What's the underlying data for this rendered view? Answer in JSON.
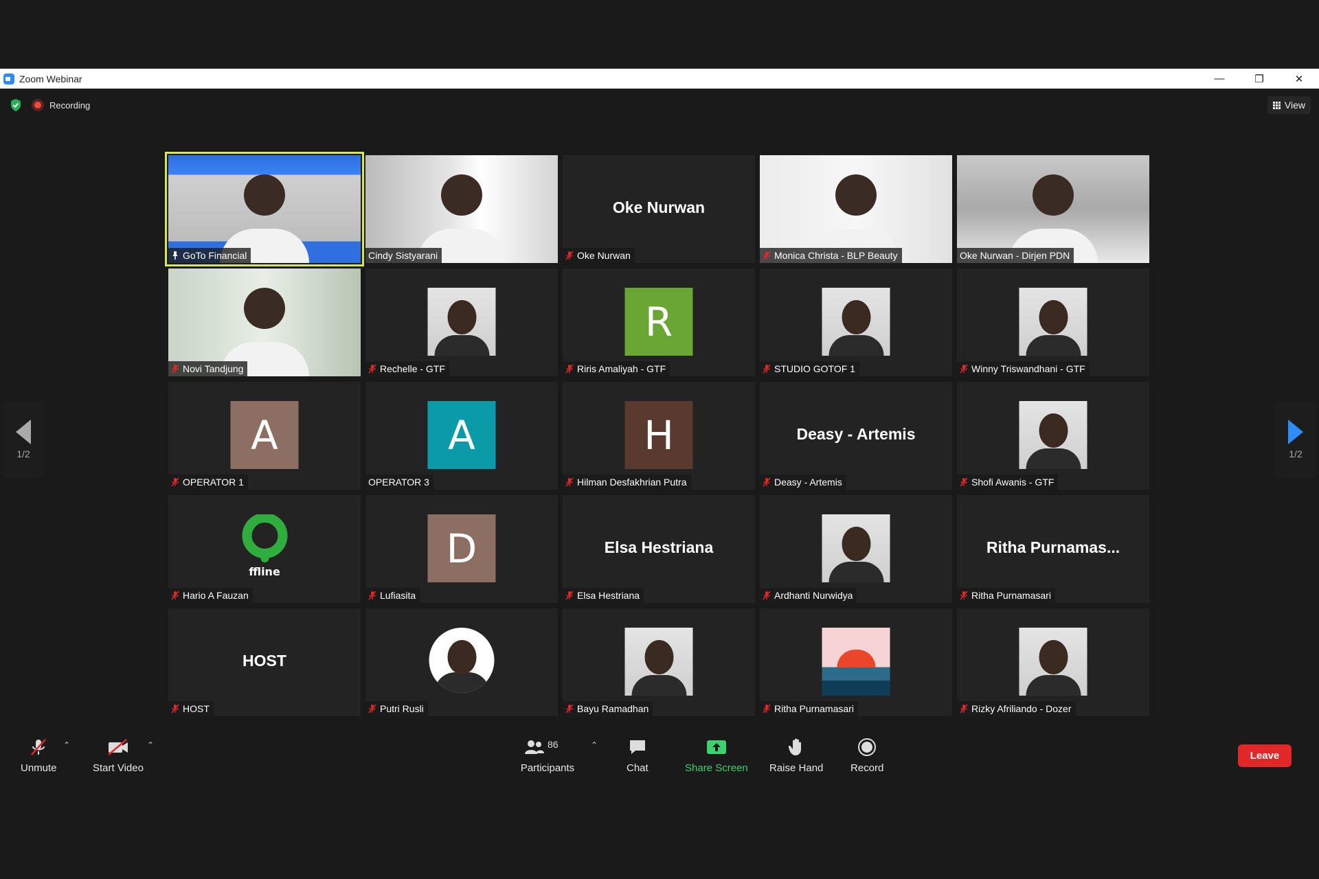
{
  "window": {
    "title": "Zoom Webinar"
  },
  "status": {
    "recording_label": "Recording"
  },
  "view_button": {
    "label": "View"
  },
  "pager": {
    "left_page": "1/2",
    "right_page": "1/2"
  },
  "tiles": [
    {
      "name": "GoTo Financial",
      "type": "video",
      "muted": false,
      "pinned": true,
      "active": true
    },
    {
      "name": "Cindy Sistyarani",
      "type": "video",
      "muted": false
    },
    {
      "name": "Oke Nurwan",
      "type": "name",
      "display": "Oke Nurwan",
      "muted": true
    },
    {
      "name": "Monica Christa - BLP Beauty",
      "type": "video",
      "muted": true
    },
    {
      "name": "Oke Nurwan - Dirjen PDN",
      "type": "video",
      "muted": false
    },
    {
      "name": "Novi Tandjung",
      "type": "video",
      "muted": true
    },
    {
      "name": "Rechelle - GTF",
      "type": "photo",
      "muted": true
    },
    {
      "name": "Riris Amaliyah - GTF",
      "type": "letter",
      "letter": "R",
      "color": "#6aa634",
      "muted": true
    },
    {
      "name": "STUDIO GOTOF 1",
      "type": "photo",
      "muted": true
    },
    {
      "name": "Winny Triswandhani - GTF",
      "type": "photo",
      "muted": true
    },
    {
      "name": "OPERATOR 1",
      "type": "letter",
      "letter": "A",
      "color": "#8c6e62",
      "muted": true
    },
    {
      "name": "OPERATOR 3",
      "type": "letter",
      "letter": "A",
      "color": "#0b9aa8",
      "muted": false
    },
    {
      "name": "Hilman Desfakhrian Putra",
      "type": "letter",
      "letter": "H",
      "color": "#5a3a2e",
      "muted": true
    },
    {
      "name": "Deasy - Artemis",
      "type": "name",
      "display": "Deasy - Artemis",
      "muted": true
    },
    {
      "name": "Shofi Awanis - GTF",
      "type": "photo",
      "muted": true
    },
    {
      "name": "Hario A Fauzan",
      "type": "logo",
      "logo_text": "ffline",
      "muted": true
    },
    {
      "name": "Lufiasita",
      "type": "letter",
      "letter": "D",
      "color": "#8c6e62",
      "muted": true
    },
    {
      "name": "Elsa Hestriana",
      "type": "name",
      "display": "Elsa Hestriana",
      "muted": true
    },
    {
      "name": "Ardhanti Nurwidya",
      "type": "photo",
      "muted": true
    },
    {
      "name": "Ritha Purnamasari",
      "type": "name",
      "display": "Ritha  Purnamas...",
      "muted": true
    },
    {
      "name": "HOST",
      "type": "name",
      "display": "HOST",
      "muted": true
    },
    {
      "name": "Putri Rusli",
      "type": "photo",
      "muted": true
    },
    {
      "name": "Bayu Ramadhan",
      "type": "photo",
      "muted": true
    },
    {
      "name": "Ritha Purnamasari",
      "type": "sunset",
      "muted": true
    },
    {
      "name": "Rizky Afriliando - Dozer",
      "type": "photo",
      "muted": true
    }
  ],
  "toolbar": {
    "unmute_label": "Unmute",
    "start_video_label": "Start Video",
    "participants_label": "Participants",
    "participants_count": "86",
    "chat_label": "Chat",
    "share_screen_label": "Share Screen",
    "raise_hand_label": "Raise Hand",
    "record_label": "Record",
    "leave_label": "Leave"
  },
  "colors": {
    "accent": "#2D8CFF",
    "share_green": "#3bd16f",
    "leave_red": "#e02828",
    "active_border": "#d9e84e"
  },
  "icons": [
    "shield-check-icon",
    "recording-icon",
    "grid-view-icon",
    "chevron-left-icon",
    "chevron-right-icon",
    "mic-off-icon",
    "video-off-icon",
    "participants-icon",
    "chat-icon",
    "share-screen-icon",
    "raise-hand-icon",
    "record-icon",
    "pin-icon"
  ]
}
